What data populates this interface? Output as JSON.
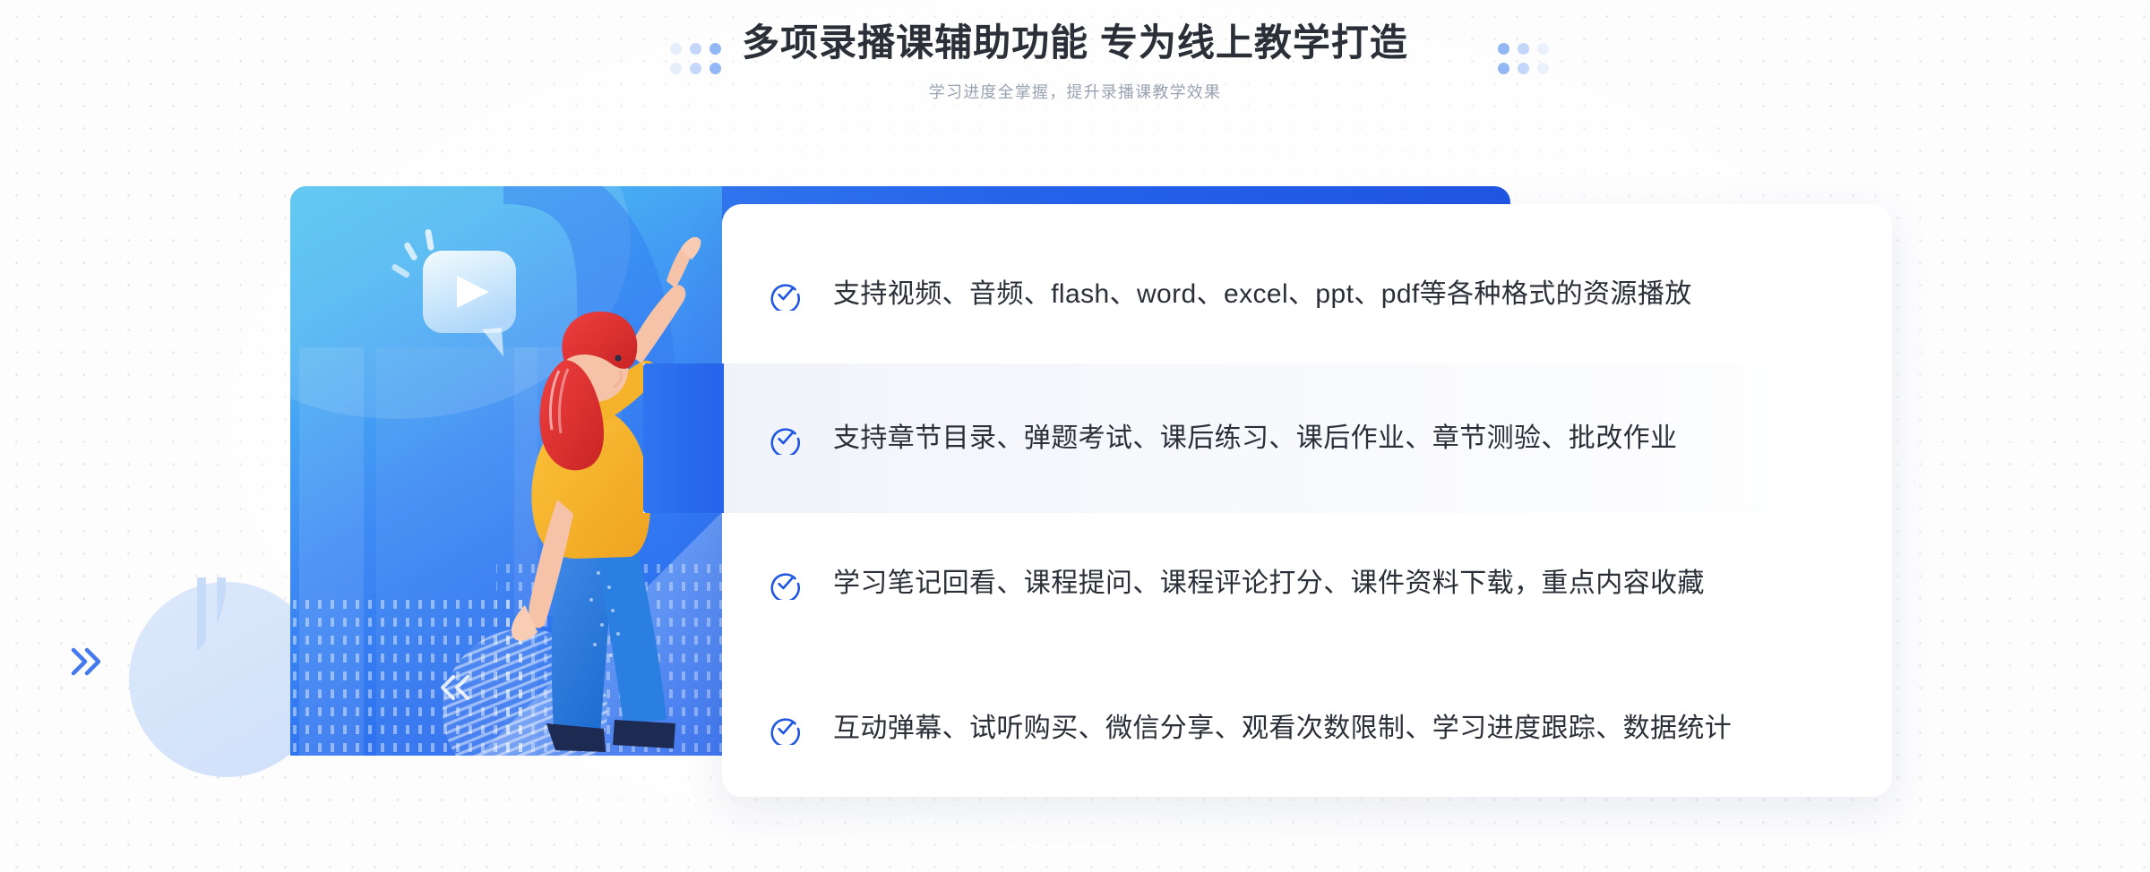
{
  "header": {
    "title": "多项录播课辅助功能 专为线上教学打造",
    "subtitle": "学习进度全掌握，提升录播课教学效果"
  },
  "decor": {
    "dot_cluster_left": "dot-cluster-left",
    "dot_cluster_right": "dot-cluster-right",
    "chevron_right": "chevron-double-right-icon",
    "chevron_left": "chevron-double-left-icon",
    "pale_circle": "decorative-circle"
  },
  "illustration": {
    "name": "woman-pointing-at-video-illustration",
    "play_bubble": "play-button-speech-bubble",
    "character": "woman-with-red-hair-pointing-up"
  },
  "colors": {
    "accent_blue": "#2563eb",
    "accent_blue_light": "#3f8cf4",
    "cyan": "#4ec3f0",
    "title": "#2b2f38",
    "subtitle": "#9aa3b2",
    "highlight_row": "#f4f6fb",
    "shirt_yellow": "#f5b32c",
    "hair_red": "#e03535",
    "pants_blue": "#2b7fe0",
    "shoe_navy": "#1d2a52",
    "skin": "#f7c3a8"
  },
  "features": [
    {
      "icon": "check-circle-icon",
      "text": "支持视频、音频、flash、word、excel、ppt、pdf等各种格式的资源播放",
      "highlighted": false
    },
    {
      "icon": "check-circle-icon",
      "text": "支持章节目录、弹题考试、课后练习、课后作业、章节测验、批改作业",
      "highlighted": true
    },
    {
      "icon": "check-circle-icon",
      "text": "学习笔记回看、课程提问、课程评论打分、课件资料下载，重点内容收藏",
      "highlighted": false
    },
    {
      "icon": "check-circle-icon",
      "text": "互动弹幕、试听购买、微信分享、观看次数限制、学习进度跟踪、数据统计",
      "highlighted": false
    }
  ]
}
